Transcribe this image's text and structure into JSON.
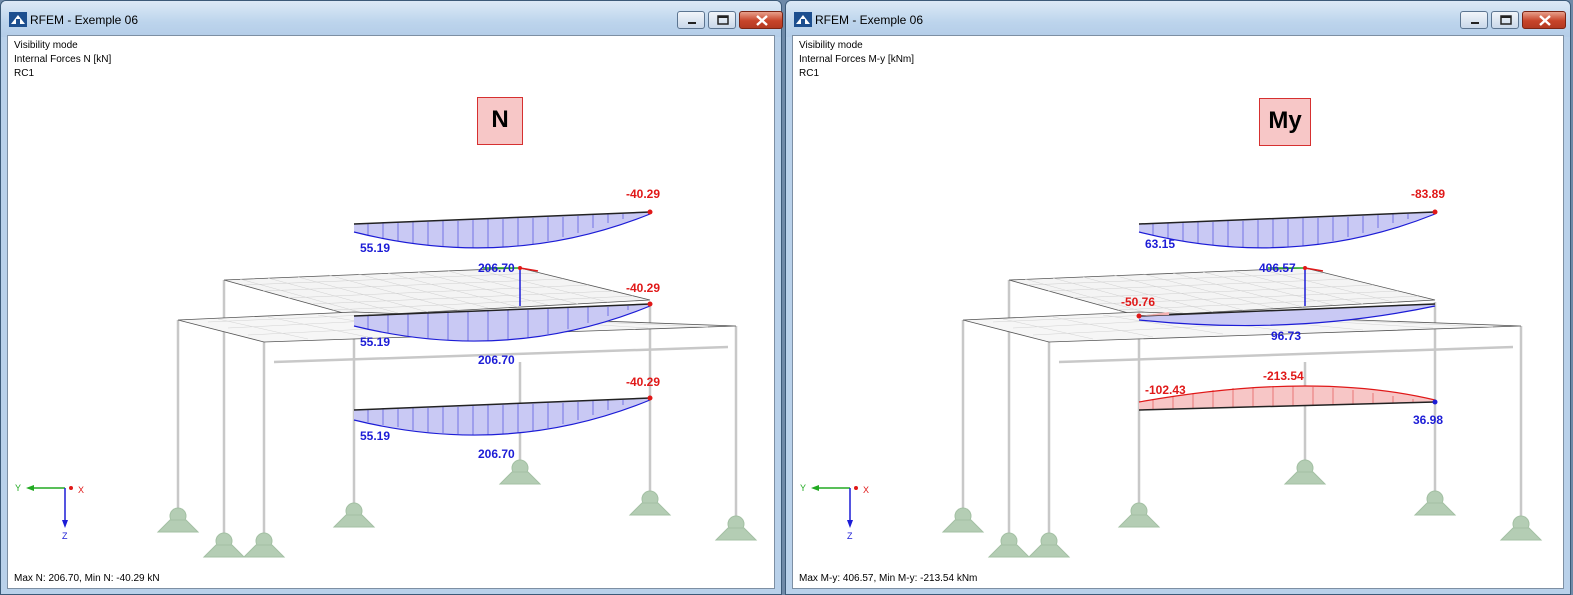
{
  "windows": [
    {
      "title": "RFEM - Exemple 06",
      "info_lines": [
        "Visibility mode",
        "Internal Forces N [kN]",
        "RC1"
      ],
      "badge": "N",
      "status": "Max N: 206.70, Min N: -40.29 kN",
      "labels": {
        "top_red": "-40.29",
        "top_blue": "55.19",
        "mid_top_blue": "206.70",
        "mid_red": "-40.29",
        "mid_left_blue": "55.19",
        "mid_center_blue": "206.70",
        "low_red": "-40.29",
        "low_left_blue": "55.19",
        "low_center_blue": "206.70"
      }
    },
    {
      "title": "RFEM - Exemple 06",
      "info_lines": [
        "Visibility mode",
        "Internal Forces M-y [kNm]",
        "RC1"
      ],
      "badge": "My",
      "status": "Max M-y: 406.57, Min M-y: -213.54 kNm",
      "labels": {
        "top_red": "-83.89",
        "top_blue": "63.15",
        "mid_top_blue": "406.57",
        "mid_left_red": "-50.76",
        "mid_center_blue": "96.73",
        "low_left_red": "-102.43",
        "low_center_red": "-213.54",
        "low_right_blue": "36.98"
      }
    }
  ],
  "axes": {
    "y": "Y",
    "x": "X",
    "z": "Z"
  },
  "colors": {
    "positive": "#1c1cd6",
    "negative": "#e01818",
    "support": "#b4cdb4",
    "grid": "#9a9a9a"
  }
}
